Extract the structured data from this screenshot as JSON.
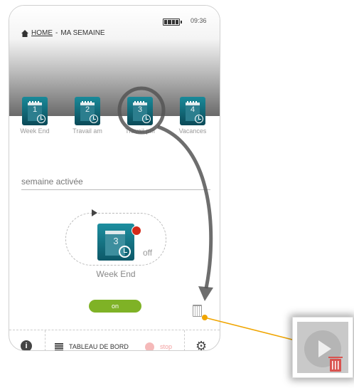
{
  "status_bar": {
    "time": "09:36"
  },
  "breadcrumb": {
    "home": "HOME",
    "separator": " - ",
    "page": "MA SEMAINE"
  },
  "day_tabs": [
    {
      "number": "1",
      "label": "Week End"
    },
    {
      "number": "2",
      "label": "Travail am"
    },
    {
      "number": "3",
      "label": "Travail pm"
    },
    {
      "number": "4",
      "label": "Vacances"
    }
  ],
  "week_field": {
    "value": "semaine activée"
  },
  "selector": {
    "number": "3",
    "state": "off",
    "name": "Week End"
  },
  "toggle": {
    "label": "on"
  },
  "bottom_bar": {
    "info": "i",
    "dashboard_label": "TABLEAU DE BORD",
    "stop_label": "stop"
  },
  "colors": {
    "tile": "#0b4a58",
    "toggle_on": "#7fb226",
    "annotation_line": "#f0a500",
    "stop": "#f5b9b9",
    "alert": "#d42a1a"
  }
}
